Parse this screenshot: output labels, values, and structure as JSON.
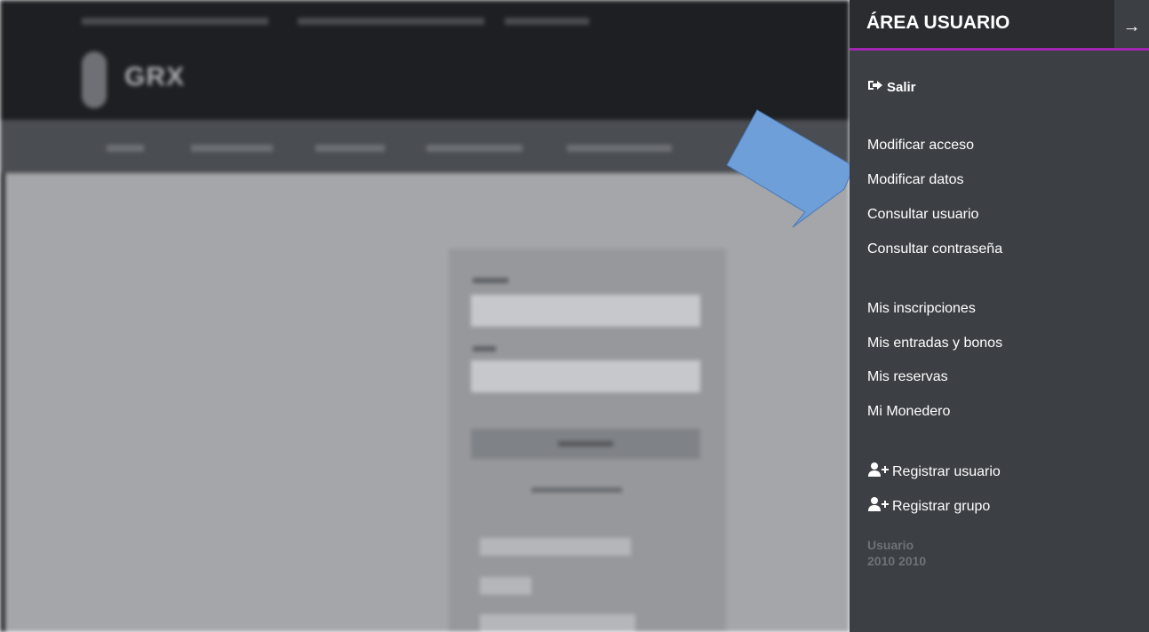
{
  "sidebar": {
    "title": "ÁREA USUARIO",
    "close_icon": "arrow-right-icon",
    "salir_label": "Salir",
    "salir_icon": "sign-out-icon",
    "group1": [
      "Modificar acceso",
      "Modificar datos",
      "Consultar usuario",
      "Consultar contraseña"
    ],
    "group2": [
      "Mis inscripciones",
      "Mis entradas y bonos",
      "Mis reservas",
      "Mi Monedero"
    ],
    "register_user": "Registrar usuario",
    "register_group": "Registrar grupo",
    "register_icon": "user-plus-icon",
    "user_label": "Usuario",
    "user_value": "2010 2010"
  },
  "background": {
    "logo_text": "GRX"
  },
  "colors": {
    "accent": "#a326b3",
    "sidebar_bg": "#3c3f44",
    "sidebar_header_bg": "#2b2c30",
    "arrow_fill": "#6f9fd8",
    "arrow_stroke": "#4a78b8"
  }
}
